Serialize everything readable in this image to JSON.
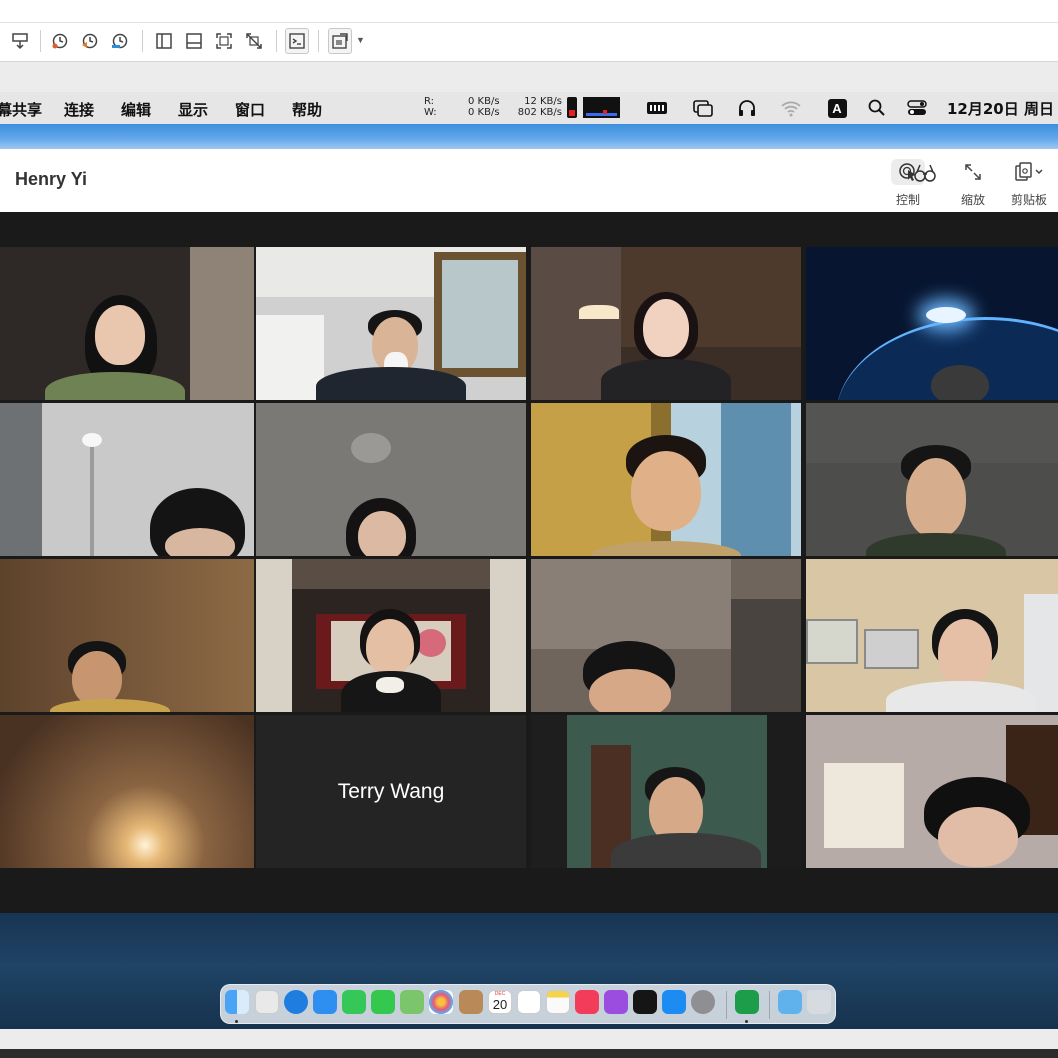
{
  "menubar": {
    "items": [
      "幕共享",
      "连接",
      "编辑",
      "显示",
      "窗口",
      "帮助"
    ],
    "net_labels": [
      "R:",
      "W:"
    ],
    "net_read": [
      "0 KB/s",
      "0 KB/s"
    ],
    "net_write": [
      "12 KB/s",
      "802 KB/s"
    ],
    "clock": "12月20日 周日",
    "icons": [
      "memory-icon",
      "screens-icon",
      "headphones-icon",
      "wifi-icon",
      "input-method-icon",
      "spotlight-icon",
      "control-center-icon"
    ]
  },
  "zoom": {
    "host_name": "Henry Yi",
    "controls": [
      {
        "label": "控制",
        "icon": "remote-control-icon"
      },
      {
        "label": "缩放",
        "icon": "scale-icon"
      },
      {
        "label": "剪贴板",
        "icon": "clipboard-icon"
      }
    ],
    "name_tile": "Terry Wang",
    "active_speaker_color": "#c8e34a"
  },
  "toolbar": {
    "icons": [
      "disconnect-icon",
      "history-icon",
      "history-back-icon",
      "history-forward-icon",
      "sidebar-icon",
      "bottom-panel-icon",
      "fit-screen-icon",
      "scale-off-icon",
      "terminal-icon",
      "screenshot-icon"
    ]
  },
  "dock": {
    "icons": [
      "finder-icon",
      "launchpad-icon",
      "safari-icon",
      "mail-icon",
      "facetime-icon",
      "messages-icon",
      "maps-icon",
      "photos-icon",
      "contacts-icon",
      "calendar-icon",
      "reminders-icon",
      "notes-icon",
      "music-icon",
      "podcasts-icon",
      "tv-icon",
      "app-store-icon",
      "system-preferences-icon",
      "screen-sharing-icon",
      "downloads-icon",
      "trash-icon"
    ],
    "calendar_day": "20",
    "calendar_month": "DEC"
  }
}
